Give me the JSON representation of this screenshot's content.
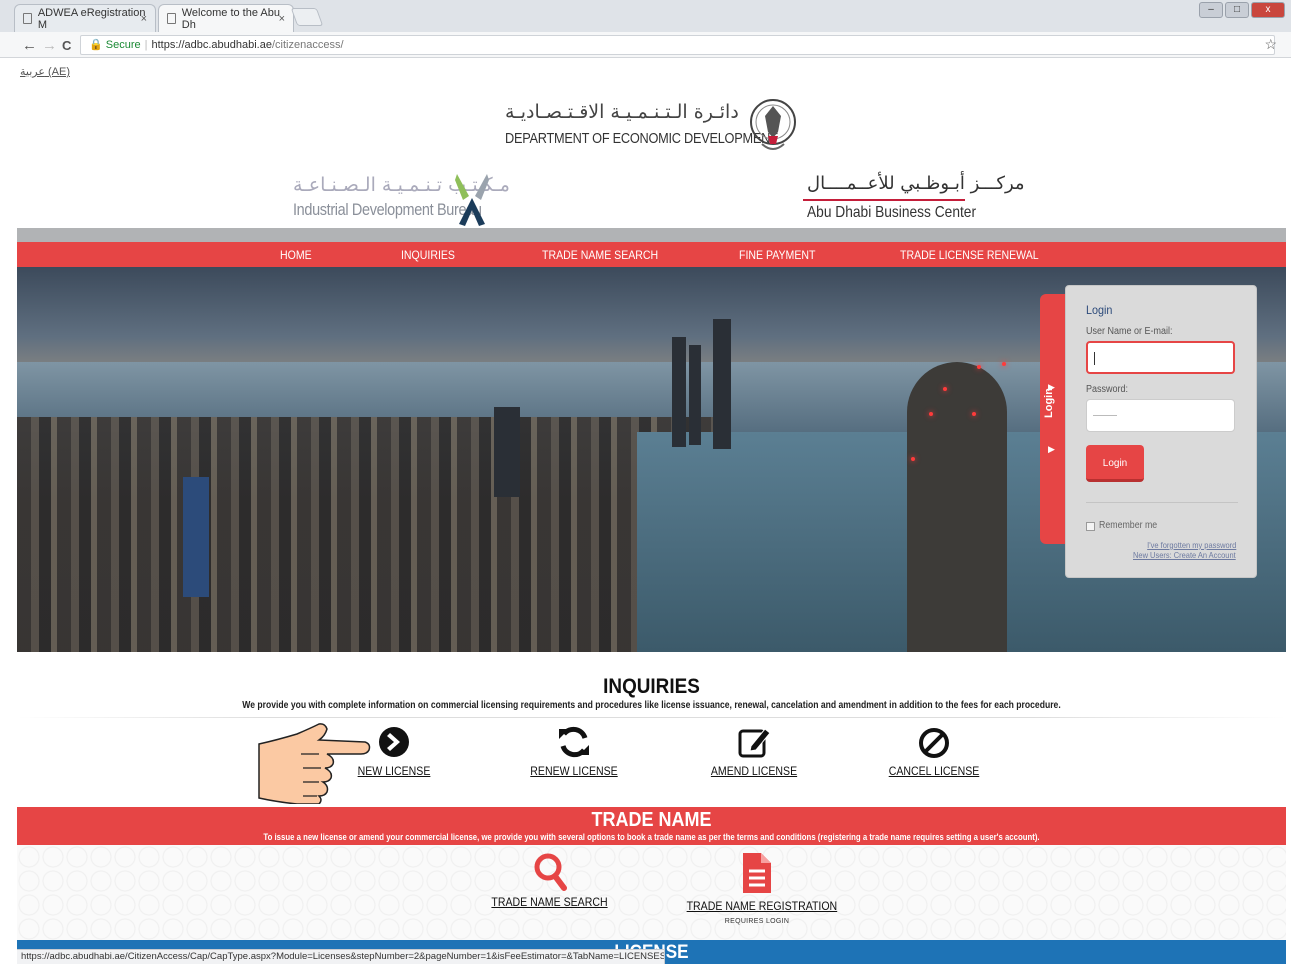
{
  "browser": {
    "tabs": [
      {
        "title": "ADWEA eRegistration M"
      },
      {
        "title": "Welcome to the Abu Dh"
      }
    ],
    "close_glyph": "×",
    "window_controls": [
      "–",
      "□",
      "x"
    ],
    "nav": {
      "back": "←",
      "forward": "→",
      "reload": "C"
    },
    "address": {
      "secure_label": "Secure",
      "separator": "|",
      "host": "https://adbc.abudhabi.ae",
      "path": "/citizenaccess/"
    },
    "bookmark_glyph": "☆",
    "status_url": "https://adbc.abudhabi.ae/CitizenAccess/Cap/CapType.aspx?Module=Licenses&stepNumber=2&pageNumber=1&isFeeEstimator=&TabName=LICENSES&FilterName=IDESKWIZ"
  },
  "header": {
    "language_link": "عربية (AE)",
    "dept_arabic": "دائـرة الـتـنـمـيـة الاقـتـصـاديـة",
    "dept_english": "DEPARTMENT OF ECONOMIC DEVELOPMENT",
    "idb_arabic": "مـكـتـب تـنـمـيـة الـصـنـاعـة",
    "idb_english": "Industrial Development Bureau",
    "adbc_arabic": "مركـــز أبـوظـبي للأعــمــــال",
    "adbc_english": "Abu Dhabi Business Center"
  },
  "nav": {
    "items": [
      {
        "label": "HOME"
      },
      {
        "label": "INQUIRIES"
      },
      {
        "label": "TRADE NAME SEARCH"
      },
      {
        "label": "FINE PAYMENT"
      },
      {
        "label": "TRADE LICENSE RENEWAL"
      }
    ]
  },
  "login": {
    "tab_label": "Login",
    "title": "Login",
    "username_label": "User Name or E-mail:",
    "password_label": "Password:",
    "button": "Login",
    "remember": "Remember me",
    "forgot": "I've forgotten my password",
    "register": "New Users: Create An Account"
  },
  "inquiries": {
    "title": "INQUIRIES",
    "description": "We provide you with complete information on commercial licensing requirements and procedures like license issuance, renewal, cancelation and amendment in addition to the fees for each procedure.",
    "services": [
      {
        "label": "NEW LICENSE",
        "icon": "arrow-right-circle-icon"
      },
      {
        "label": "RENEW LICENSE",
        "icon": "refresh-icon"
      },
      {
        "label": "AMEND LICENSE",
        "icon": "edit-icon"
      },
      {
        "label": "CANCEL LICENSE",
        "icon": "ban-icon"
      }
    ]
  },
  "trade_name": {
    "title": "TRADE NAME",
    "description": "To issue a new license or amend your commercial license, we provide you with several options to book a trade name as per the terms and conditions (registering a trade name requires setting a user's account).",
    "services": [
      {
        "label": "TRADE NAME SEARCH",
        "icon": "search-icon"
      },
      {
        "label": "TRADE NAME REGISTRATION",
        "icon": "document-icon",
        "note": "REQUIRES LOGIN"
      }
    ]
  },
  "license_band": {
    "title": "LICENSE"
  },
  "colors": {
    "brand_red": "#e64545",
    "brand_blue": "#1e73b6",
    "grey_bar": "#b1b3b5"
  }
}
